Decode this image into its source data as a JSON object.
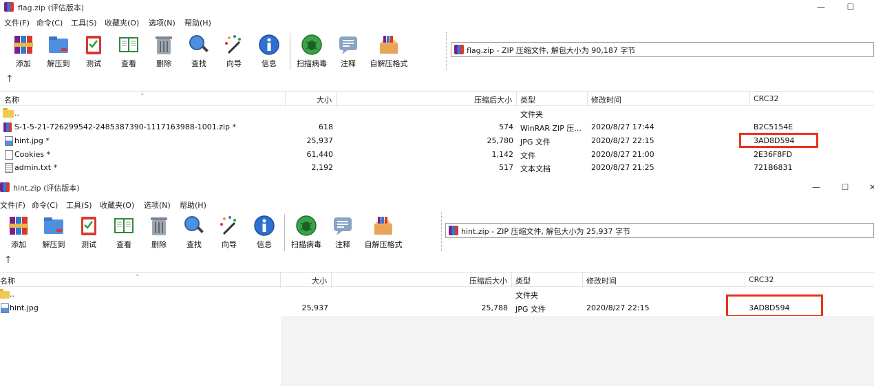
{
  "win1": {
    "title": "flag.zip (评估版本)",
    "menu": [
      "文件(F)",
      "命令(C)",
      "工具(S)",
      "收藏夹(O)",
      "选项(N)",
      "帮助(H)"
    ],
    "toolbar": [
      {
        "label": "添加",
        "icon": "add-archive-icon"
      },
      {
        "label": "解压到",
        "icon": "extract-to-icon"
      },
      {
        "label": "测试",
        "icon": "test-icon"
      },
      {
        "label": "查看",
        "icon": "view-book-icon"
      },
      {
        "label": "删除",
        "icon": "trash-icon"
      },
      {
        "label": "查找",
        "icon": "magnifier-icon"
      },
      {
        "label": "向导",
        "icon": "wizard-wand-icon"
      },
      {
        "label": "信息",
        "icon": "info-icon"
      },
      {
        "label": "扫描病毒",
        "icon": "virus-scan-icon"
      },
      {
        "label": "注释",
        "icon": "comment-icon"
      },
      {
        "label": "自解压格式",
        "icon": "sfx-box-icon"
      }
    ],
    "address": "flag.zip - ZIP 压缩文件, 解包大小为 90,187 字节",
    "columns": {
      "name": "名称",
      "size": "大小",
      "packed": "压缩后大小",
      "type": "类型",
      "modified": "修改时间",
      "crc": "CRC32"
    },
    "rows": [
      {
        "name": "..",
        "size": "",
        "packed": "",
        "type": "文件夹",
        "modified": "",
        "crc": "",
        "icon": "folder-icon"
      },
      {
        "name": "S-1-5-21-726299542-2485387390-1117163988-1001.zip *",
        "size": "618",
        "packed": "574",
        "type": "WinRAR ZIP 压...",
        "modified": "2020/8/27 17:44",
        "crc": "B2C5154E",
        "icon": "rar-file-icon"
      },
      {
        "name": "hint.jpg *",
        "size": "25,937",
        "packed": "25,780",
        "type": "JPG 文件",
        "modified": "2020/8/27 22:15",
        "crc": "3AD8D594",
        "icon": "jpg-file-icon"
      },
      {
        "name": "Cookies *",
        "size": "61,440",
        "packed": "1,142",
        "type": "文件",
        "modified": "2020/8/27 21:00",
        "crc": "2E36F8FD",
        "icon": "blank-file-icon"
      },
      {
        "name": "admin.txt *",
        "size": "2,192",
        "packed": "517",
        "type": "文本文档",
        "modified": "2020/8/27 21:25",
        "crc": "721B6831",
        "icon": "text-file-icon"
      }
    ]
  },
  "win2": {
    "title": "hint.zip (评估版本)",
    "menu": [
      "文件(F)",
      "命令(C)",
      "工具(S)",
      "收藏夹(O)",
      "选项(N)",
      "帮助(H)"
    ],
    "toolbar": [
      {
        "label": "添加",
        "icon": "add-archive-icon"
      },
      {
        "label": "解压到",
        "icon": "extract-to-icon"
      },
      {
        "label": "测试",
        "icon": "test-icon"
      },
      {
        "label": "查看",
        "icon": "view-book-icon"
      },
      {
        "label": "删除",
        "icon": "trash-icon"
      },
      {
        "label": "查找",
        "icon": "magnifier-icon"
      },
      {
        "label": "向导",
        "icon": "wizard-wand-icon"
      },
      {
        "label": "信息",
        "icon": "info-icon"
      },
      {
        "label": "扫描病毒",
        "icon": "virus-scan-icon"
      },
      {
        "label": "注释",
        "icon": "comment-icon"
      },
      {
        "label": "自解压格式",
        "icon": "sfx-box-icon"
      }
    ],
    "address": "hint.zip - ZIP 压缩文件, 解包大小为 25,937 字节",
    "columns": {
      "name": "名称",
      "size": "大小",
      "packed": "压缩后大小",
      "type": "类型",
      "modified": "修改时间",
      "crc": "CRC32"
    },
    "rows": [
      {
        "name": "..",
        "size": "",
        "packed": "",
        "type": "文件夹",
        "modified": "",
        "crc": "",
        "icon": "folder-icon"
      },
      {
        "name": "hint.jpg",
        "size": "25,937",
        "packed": "25,788",
        "type": "JPG 文件",
        "modified": "2020/8/27 22:15",
        "crc": "3AD8D594",
        "icon": "jpg-file-icon"
      }
    ]
  },
  "highlight_color": "#e8321f"
}
